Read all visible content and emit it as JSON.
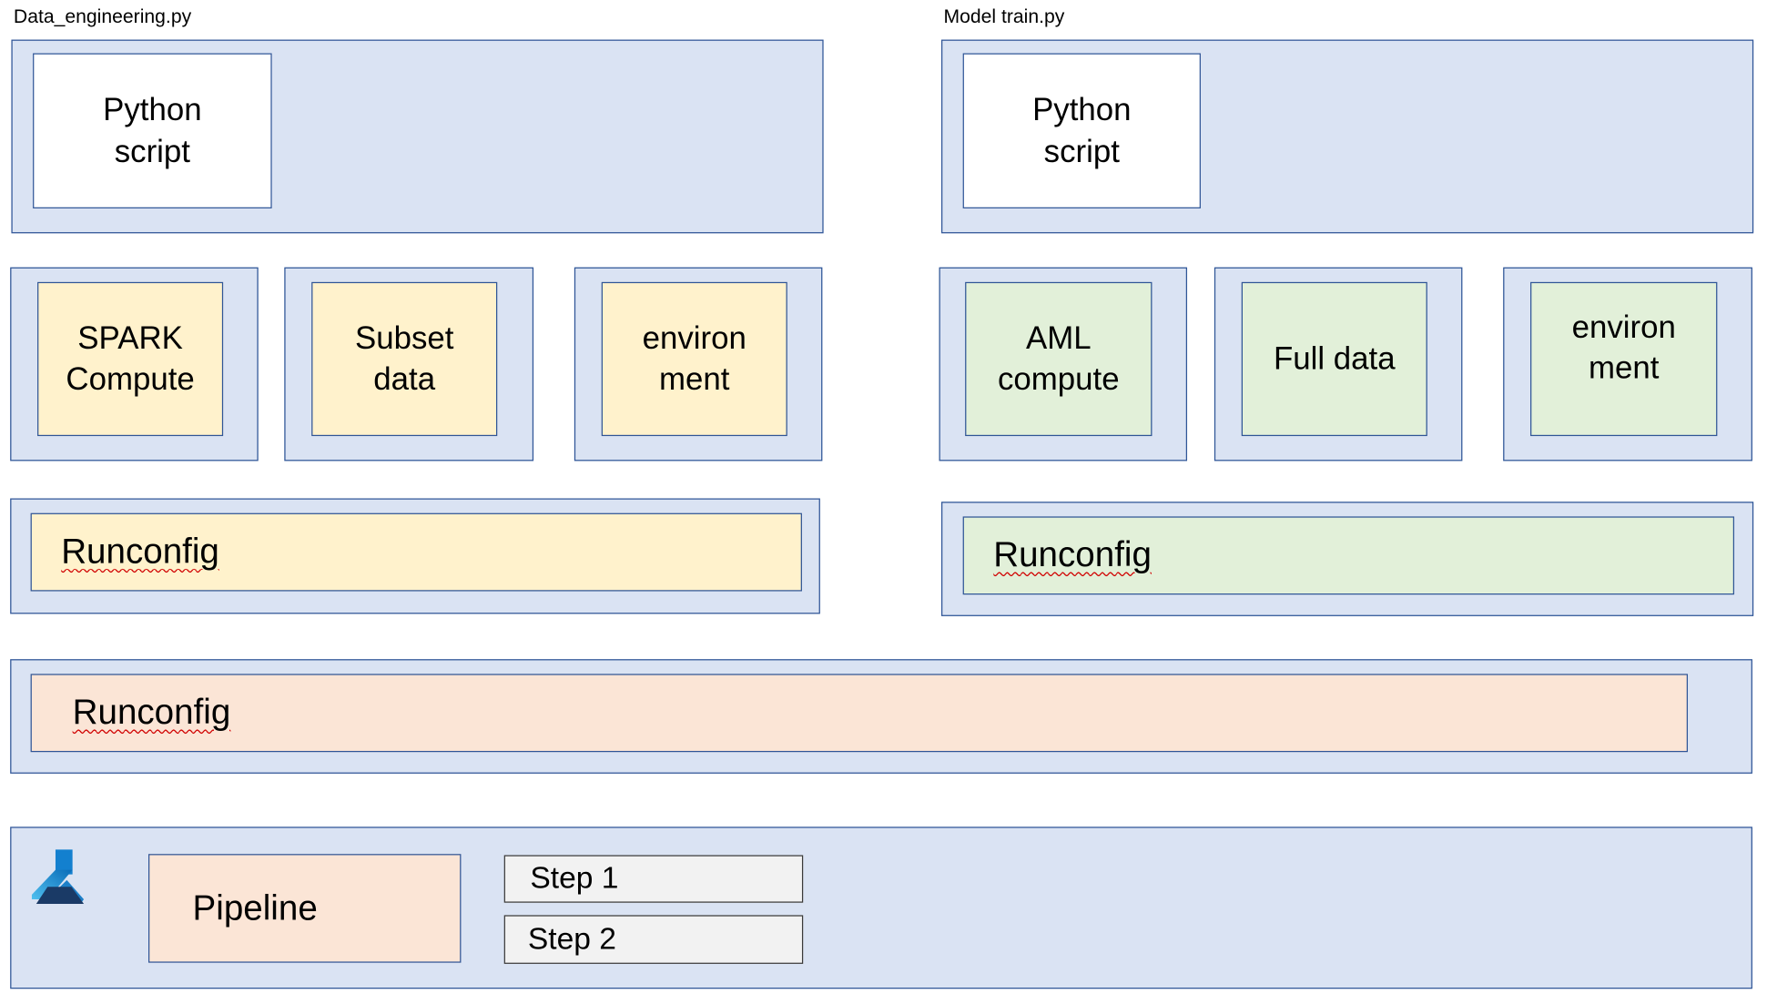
{
  "left": {
    "file_label": "Data_engineering.py",
    "script": "Python script",
    "compute": "SPARK Compute",
    "data": "Subset data",
    "environment": "environ ment",
    "runconfig": "Runconfig"
  },
  "right": {
    "file_label": "Model train.py",
    "script": "Python script",
    "compute": "AML compute",
    "data": "Full data",
    "environment": "environ ment",
    "runconfig": "Runconfig"
  },
  "combined_runconfig": "Runconfig",
  "pipeline": {
    "icon": "azure-machine-learning-icon",
    "label": "Pipeline",
    "steps": [
      "Step 1",
      "Step 2"
    ]
  },
  "colors": {
    "container": "#dae3f3",
    "border": "#2f5597",
    "spark_side": "#fff2cc",
    "aml_side": "#e2f0d9",
    "pipeline": "#fbe5d6",
    "step": "#f2f2f2"
  }
}
